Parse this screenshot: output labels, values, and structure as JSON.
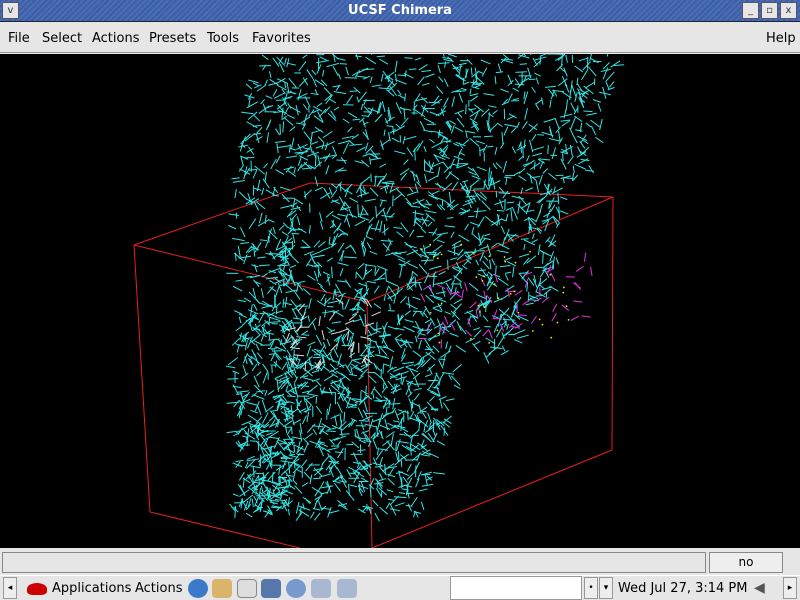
{
  "window": {
    "title": "UCSF Chimera"
  },
  "menu": [
    "File",
    "Select",
    "Actions",
    "Presets",
    "Tools",
    "Favorites"
  ],
  "help": "Help",
  "status": {
    "message": "",
    "selection": "no selection"
  },
  "taskbar": {
    "applications": "Applications",
    "actions": "Actions",
    "clock": "Wed Jul 27,  3:14 PM"
  },
  "colors": {
    "protein": "#33e6e6",
    "ligand": "#e633e6",
    "box": "#e62020",
    "white_ligand": "#dddddd"
  }
}
